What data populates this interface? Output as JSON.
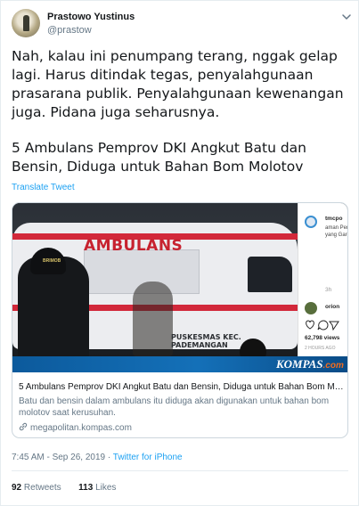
{
  "author": {
    "name": "Prastowo Yustinus",
    "handle": "@prastow"
  },
  "tweet": {
    "paragraph1": "Nah, kalau ini penumpang terang, nggak gelap lagi. Harus ditindak tegas, penyalahgunaan prasarana publik. Penyalahgunaan kewenangan juga. Pidana juga seharusnya.",
    "paragraph2": "5 Ambulans Pemprov DKI Angkut Batu dan Bensin, Diduga untuk Bahan Bom Molotov",
    "translate_label": "Translate Tweet"
  },
  "card": {
    "media_texts": {
      "van_text": "AMBULANS",
      "van_sub_text": "PUSKESMAS KEC. PADEMANGAN",
      "officer_badge": "BRIMOB"
    },
    "instagram": {
      "username": "tmcpo",
      "caption": "aman Pempr untuk yang Gardu Subro",
      "time": "3h",
      "commenter": "orion",
      "views": "62,798 views",
      "ago": "2 HOURS AGO"
    },
    "brand": {
      "name": "KOMPAS",
      "tld": ".com"
    },
    "title": "5 Ambulans Pemprov DKI Angkut Batu dan Bensin, Diduga untuk Bahan Bom Mo...",
    "description": "Batu dan bensin dalam ambulans itu diduga akan digunakan untuk bahan bom molotov saat kerusuhan.",
    "domain": "megapolitan.kompas.com"
  },
  "meta": {
    "timestamp": "7:45 AM - Sep 26, 2019",
    "separator": " · ",
    "source": "Twitter for iPhone"
  },
  "stats": {
    "retweets_count": "92",
    "retweets_label": "Retweets",
    "likes_count": "113",
    "likes_label": "Likes"
  },
  "icons": [
    "avatar",
    "chevron-down-icon",
    "link-icon",
    "heart-icon",
    "comment-icon",
    "share-icon"
  ],
  "colors": {
    "accent": "#1da1f2",
    "secondary_text": "#657786",
    "kompas_blue": "#1470b8",
    "ambulance_red": "#d2283a"
  }
}
